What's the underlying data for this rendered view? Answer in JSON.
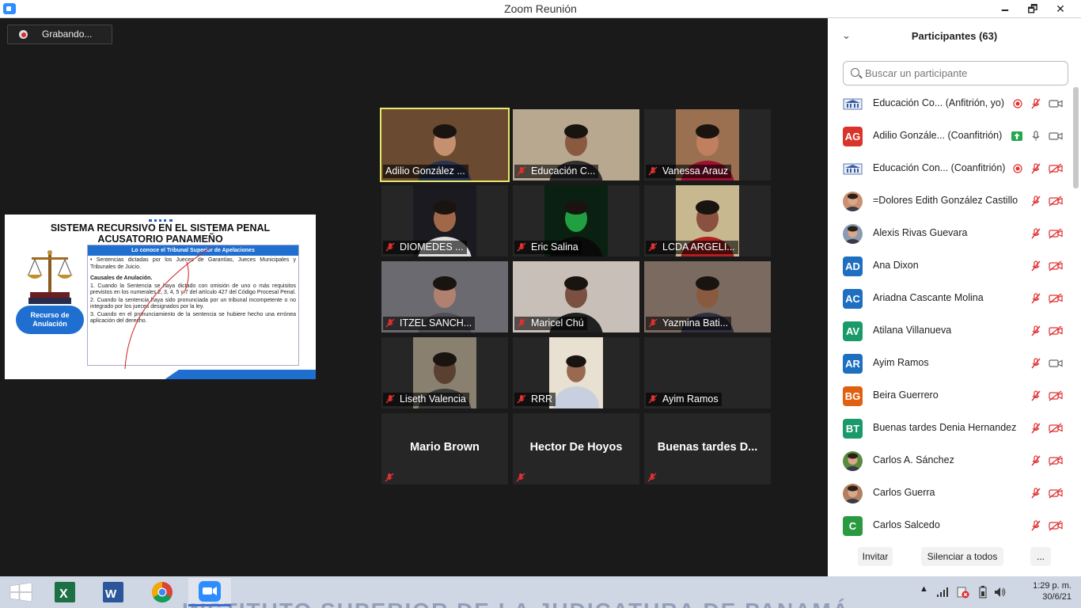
{
  "window": {
    "title": "Zoom Reunión",
    "minimize": "🗕",
    "maximize": "🗗",
    "close": "✕"
  },
  "recording": {
    "label": "Grabando..."
  },
  "slide": {
    "title": "SISTEMA RECURSIVO EN EL SISTEMA PENAL ACUSATORIO PANAMEÑO",
    "pill": "Recurso de Anulación",
    "box_header": "Lo conoce el Tribunal Superior de Apelaciones",
    "bullet": "• Sentencias dictadas por los Jueces de Garantías, Jueces Municipales y Tribunales de Juicio.",
    "causales_title": "Causales de Anulación.",
    "item1": "1. Cuando la Sentencia se haya dictado con omisión de uno o más requisitos previstos en los numerales 2, 3, 4, 5 y 7 del artículo 427 del Código Procesal Penal.",
    "item2": "2. Cuando la sentencia haya sido pronunciada por un tribunal incompetente o no integrado por los jueces designados por la ley.",
    "item3": "3. Cuando en el pronunciamiento de la sentencia se hubiere hecho una errónea aplicación del derecho."
  },
  "tiles": [
    {
      "name": "Adilio González ...",
      "muted": false,
      "active": true,
      "bg": "#6a4a30",
      "face": "#c49070",
      "shirt": "#2a3350"
    },
    {
      "name": "Educación C...",
      "muted": true,
      "bg": "#b8a890",
      "face": "#8a5a40",
      "shirt": "#303030"
    },
    {
      "name": "Vanessa Arauz",
      "muted": true,
      "bg": "#9a7050",
      "face": "#c08060",
      "shirt": "#a01030"
    },
    {
      "name": "DIOMEDES ...",
      "muted": true,
      "bg": "#1a1a20",
      "face": "#a06848",
      "shirt": "#e0e0e0"
    },
    {
      "name": "Eric Salina",
      "muted": true,
      "bg": "#0a2010",
      "face": "#20a040",
      "shirt": "#0a0a0a"
    },
    {
      "name": "LCDA ARGELI...",
      "muted": true,
      "bg": "#c8b890",
      "face": "#8a5040",
      "shirt": "#b02020"
    },
    {
      "name": "ITZEL SANCH...",
      "muted": true,
      "bg": "#6a6a70",
      "face": "#b08070",
      "shirt": "#505058"
    },
    {
      "name": "Maricel Chú",
      "muted": true,
      "bg": "#c8c0b8",
      "face": "#7a5040",
      "shirt": "#202020"
    },
    {
      "name": "Yazmina Bati...",
      "muted": true,
      "bg": "#7a6a60",
      "face": "#8a5a40",
      "shirt": "#303040"
    },
    {
      "name": "Liseth Valencia",
      "muted": true,
      "bg": "#8a8070",
      "face": "#5a4030",
      "shirt": "#3a3a3a"
    },
    {
      "name": "RRR",
      "muted": true,
      "bg": "#e8e0d0",
      "face": "#9a6a50",
      "shirt": "#c8d0e0"
    },
    {
      "name": "Ayim Ramos",
      "muted": true,
      "bg": "#262626",
      "face": "",
      "shirt": ""
    },
    {
      "name": "Mario Brown",
      "muted": true,
      "bg": "#262626",
      "face": "",
      "shirt": "",
      "text_only": true
    },
    {
      "name": "Hector De Hoyos",
      "muted": true,
      "bg": "#262626",
      "face": "",
      "shirt": "",
      "text_only": true
    },
    {
      "name": "Buenas tardes D...",
      "muted": true,
      "bg": "#262626",
      "face": "",
      "shirt": "",
      "text_only": true
    }
  ],
  "participants": {
    "title": "Participantes (63)",
    "collapse_icon": "chevron-down-icon",
    "search_placeholder": "Buscar un participante",
    "list": [
      {
        "name": "Educación Co... (Anfitrión, yo)",
        "avatar": "",
        "color": "#ffffff",
        "logo": true,
        "rec": true,
        "mic": "muted",
        "cam": "on"
      },
      {
        "name": "Adilio Gonzále... (Coanfitrión)",
        "avatar": "AG",
        "color": "#d9342b",
        "share": true,
        "mic": "on",
        "cam": "on"
      },
      {
        "name": "Educación Con... (Coanfitrión)",
        "avatar": "",
        "color": "#ffffff",
        "logo": true,
        "rec": true,
        "mic": "muted",
        "cam": "off"
      },
      {
        "name": "=Dolores Edith González Castillo",
        "avatar": "",
        "color": "#c89070",
        "photo": true,
        "mic": "muted",
        "cam": "off"
      },
      {
        "name": "Alexis Rivas Guevara",
        "avatar": "",
        "color": "#8a9ab0",
        "photo": true,
        "mic": "muted",
        "cam": "off"
      },
      {
        "name": "Ana Dixon",
        "avatar": "AD",
        "color": "#1e6fc0",
        "mic": "muted",
        "cam": "off"
      },
      {
        "name": "Ariadna Cascante Molina",
        "avatar": "AC",
        "color": "#1e6fc0",
        "mic": "muted",
        "cam": "off"
      },
      {
        "name": "Atilana Villanueva",
        "avatar": "AV",
        "color": "#1a9a6a",
        "mic": "muted",
        "cam": "off"
      },
      {
        "name": "Ayim Ramos",
        "avatar": "AR",
        "color": "#1e6fc0",
        "mic": "muted",
        "cam": "on"
      },
      {
        "name": "Beira Guerrero",
        "avatar": "BG",
        "color": "#e06010",
        "mic": "muted",
        "cam": "off"
      },
      {
        "name": "Buenas tardes Denia Hernandez",
        "avatar": "BT",
        "color": "#1a9a6a",
        "mic": "muted",
        "cam": "off"
      },
      {
        "name": "Carlos A. Sánchez",
        "avatar": "",
        "color": "#5a8a40",
        "photo": true,
        "mic": "muted",
        "cam": "off"
      },
      {
        "name": "Carlos Guerra",
        "avatar": "",
        "color": "#b08060",
        "photo": true,
        "mic": "muted",
        "cam": "off"
      },
      {
        "name": "Carlos Salcedo",
        "avatar": "C",
        "color": "#2a9a40",
        "mic": "muted",
        "cam": "off"
      }
    ],
    "invite": "Invitar",
    "mute_all": "Silenciar a todos",
    "more": "..."
  },
  "taskbar": {
    "background_text": "INSTITUTO SUPERIOR DE LA JUDICATURA DE PANAMÁ",
    "apps": [
      "windows-start-icon",
      "excel-icon",
      "word-icon",
      "chrome-icon",
      "zoom-icon"
    ],
    "time": "1:29 p. m.",
    "date": "30/6/21"
  }
}
